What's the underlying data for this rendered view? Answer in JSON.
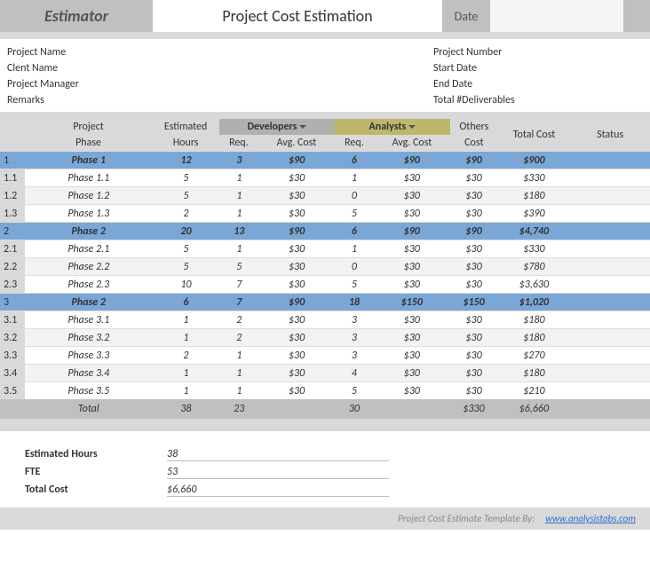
{
  "header": {
    "estimator": "Estimator",
    "title": "Project Cost Estimation",
    "date_label": "Date"
  },
  "meta": {
    "left": [
      "Project Name",
      "Clent Name",
      "Project Manager",
      "Remarks"
    ],
    "right": [
      "Project Number",
      "Start Date",
      "End Date",
      "Total #Deliverables"
    ]
  },
  "columns": {
    "project": "Project",
    "phase": "Phase",
    "estimated": "Estimated",
    "hours": "Hours",
    "developers": "Developers",
    "analysts": "Analysts",
    "req": "Req.",
    "avg_cost": "Avg. Cost",
    "others": "Others",
    "cost": "Cost",
    "total_cost": "Total Cost",
    "status": "Status"
  },
  "rows": [
    {
      "idx": "1",
      "phase": "Phase 1",
      "hours": "12",
      "dev_req": "3",
      "dev_avg": "$90",
      "ana_req": "6",
      "ana_avg": "$90",
      "others": "$90",
      "total": "$900",
      "type": "phase"
    },
    {
      "idx": "1.1",
      "phase": "Phase 1.1",
      "hours": "5",
      "dev_req": "1",
      "dev_avg": "$30",
      "ana_req": "1",
      "ana_avg": "$30",
      "others": "$30",
      "total": "$330",
      "type": "sub"
    },
    {
      "idx": "1.2",
      "phase": "Phase 1.2",
      "hours": "5",
      "dev_req": "1",
      "dev_avg": "$30",
      "ana_req": "0",
      "ana_avg": "$30",
      "others": "$30",
      "total": "$180",
      "type": "alt"
    },
    {
      "idx": "1.3",
      "phase": "Phase 1.3",
      "hours": "2",
      "dev_req": "1",
      "dev_avg": "$30",
      "ana_req": "5",
      "ana_avg": "$30",
      "others": "$30",
      "total": "$390",
      "type": "sub"
    },
    {
      "idx": "2",
      "phase": "Phase 2",
      "hours": "20",
      "dev_req": "13",
      "dev_avg": "$90",
      "ana_req": "6",
      "ana_avg": "$90",
      "others": "$90",
      "total": "$4,740",
      "type": "phase"
    },
    {
      "idx": "2.1",
      "phase": "Phase 2.1",
      "hours": "5",
      "dev_req": "1",
      "dev_avg": "$30",
      "ana_req": "1",
      "ana_avg": "$30",
      "others": "$30",
      "total": "$330",
      "type": "sub"
    },
    {
      "idx": "2.2",
      "phase": "Phase 2.2",
      "hours": "5",
      "dev_req": "5",
      "dev_avg": "$30",
      "ana_req": "0",
      "ana_avg": "$30",
      "others": "$30",
      "total": "$780",
      "type": "alt"
    },
    {
      "idx": "2.3",
      "phase": "Phase 2.3",
      "hours": "10",
      "dev_req": "7",
      "dev_avg": "$30",
      "ana_req": "5",
      "ana_avg": "$30",
      "others": "$30",
      "total": "$3,630",
      "type": "sub"
    },
    {
      "idx": "3",
      "phase": "Phase 2",
      "hours": "6",
      "dev_req": "7",
      "dev_avg": "$90",
      "ana_req": "18",
      "ana_avg": "$150",
      "others": "$150",
      "total": "$1,020",
      "type": "phase"
    },
    {
      "idx": "3.1",
      "phase": "Phase 3.1",
      "hours": "1",
      "dev_req": "2",
      "dev_avg": "$30",
      "ana_req": "3",
      "ana_avg": "$30",
      "others": "$30",
      "total": "$180",
      "type": "sub"
    },
    {
      "idx": "3.2",
      "phase": "Phase 3.2",
      "hours": "1",
      "dev_req": "2",
      "dev_avg": "$30",
      "ana_req": "3",
      "ana_avg": "$30",
      "others": "$30",
      "total": "$180",
      "type": "alt"
    },
    {
      "idx": "3.3",
      "phase": "Phase 3.3",
      "hours": "2",
      "dev_req": "1",
      "dev_avg": "$30",
      "ana_req": "3",
      "ana_avg": "$30",
      "others": "$30",
      "total": "$270",
      "type": "sub"
    },
    {
      "idx": "3.4",
      "phase": "Phase 3.4",
      "hours": "1",
      "dev_req": "1",
      "dev_avg": "$30",
      "ana_req": "4",
      "ana_avg": "$30",
      "others": "$30",
      "total": "$180",
      "type": "alt"
    },
    {
      "idx": "3.5",
      "phase": "Phase 3.5",
      "hours": "1",
      "dev_req": "1",
      "dev_avg": "$30",
      "ana_req": "5",
      "ana_avg": "$30",
      "others": "$30",
      "total": "$210",
      "type": "sub"
    }
  ],
  "totals": {
    "label": "Total",
    "hours": "38",
    "dev_req": "23",
    "ana_req": "30",
    "others": "$330",
    "total": "$6,660"
  },
  "summary": {
    "est_hours_label": "Estimated Hours",
    "est_hours": "38",
    "fte_label": "FTE",
    "fte": "53",
    "total_cost_label": "Total Cost",
    "total_cost": "$6,660"
  },
  "footer": {
    "text": "Project Cost Estimate Template By:",
    "link": "www.analysistabs.com"
  }
}
